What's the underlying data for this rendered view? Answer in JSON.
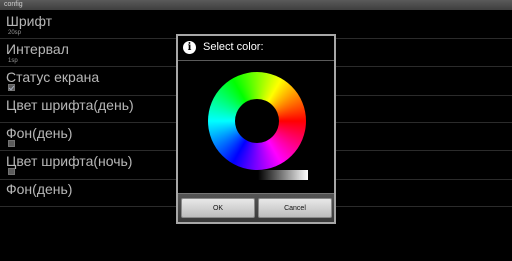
{
  "window": {
    "title": "config"
  },
  "preferences": [
    {
      "title": "Шрифт",
      "summary": "20sp"
    },
    {
      "title": "Интервал",
      "summary": "1sp"
    },
    {
      "title": "Статус екрана",
      "checked": true
    },
    {
      "title": "Цвет шрифта(день)"
    },
    {
      "title": "Фон(день)",
      "checked": false
    },
    {
      "title": "Цвет шрифта(ночь)",
      "checked": false
    },
    {
      "title": "Фон(день)"
    }
  ],
  "dialog": {
    "title": "Select color:",
    "icon": "info-icon",
    "ok_label": "OK",
    "cancel_label": "Cancel"
  }
}
